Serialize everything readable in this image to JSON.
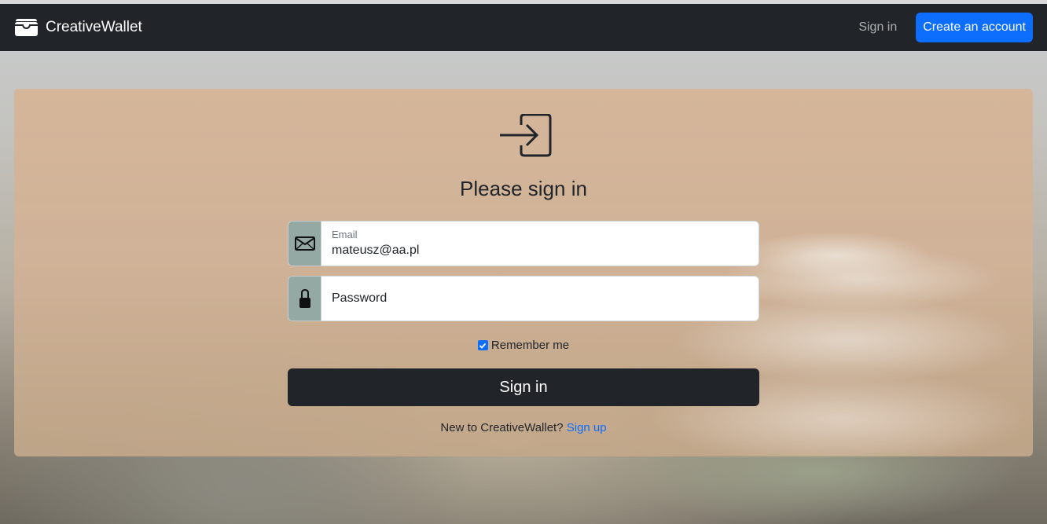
{
  "navbar": {
    "brand_icon": "wallet-icon",
    "brand_name": "CreativeWallet",
    "signin_link": "Sign in",
    "create_account_button": "Create an account"
  },
  "form": {
    "header_icon": "box-arrow-in-right-icon",
    "title": "Please sign in",
    "email": {
      "icon": "envelope-icon",
      "label": "Email",
      "value": "mateusz@aa.pl"
    },
    "password": {
      "icon": "lock-icon",
      "placeholder": "Password"
    },
    "remember_me": {
      "label": "Remember me",
      "checked": true
    },
    "submit_button": "Sign in",
    "signup_prompt": "New to CreativeWallet?",
    "signup_link": "Sign up"
  },
  "colors": {
    "navbar_bg": "#212529",
    "primary": "#0d6efd",
    "dark_button": "#212529",
    "input_addon": "#94a8a4"
  }
}
